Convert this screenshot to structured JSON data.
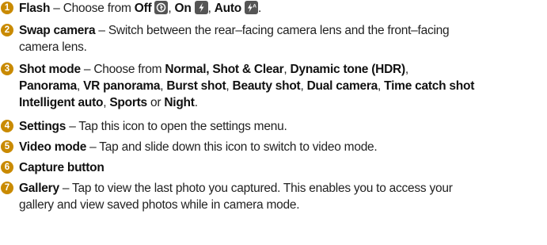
{
  "items": [
    {
      "number": "1",
      "lines": [
        [
          "Flash",
          " – Choose from ",
          "Off",
          ", ",
          "On",
          ", ",
          "Auto",
          "."
        ]
      ],
      "icons": [
        "flash-off-icon",
        "flash-on-icon",
        "flash-auto-icon"
      ]
    },
    {
      "number": "2",
      "title": "Swap camera",
      "desc_line1": " – Switch between the rear–facing camera lens and the front–facing",
      "desc_line2": "camera lens."
    },
    {
      "number": "3",
      "title": "Shot mode",
      "desc_line1": " – Choose from ",
      "modes": [
        "Normal, Shot & Clear",
        "Dynamic tone (HDR)",
        "Panorama",
        "VR panorama",
        "Burst shot",
        "Beauty shot",
        "Dual camera",
        "Time catch shot",
        "Intelligent auto",
        "Sports",
        "Night"
      ],
      "sep": ", ",
      "or": " or ",
      "end": "."
    },
    {
      "number": "4",
      "title": "Settings",
      "desc": " – Tap this icon to open the settings menu."
    },
    {
      "number": "5",
      "title": "Video mode",
      "desc": " –  Tap and slide down this icon to switch to video mode."
    },
    {
      "number": "6",
      "title": "Capture button"
    },
    {
      "number": "7",
      "title": "Gallery",
      "desc_line1": " – Tap to view the last photo you captured. This enables you to access your",
      "desc_line2": "gallery and view saved photos while in camera mode."
    }
  ],
  "colors": {
    "number_badge": "#c98a00",
    "icon_bg": "#555555",
    "text": "#222222"
  }
}
